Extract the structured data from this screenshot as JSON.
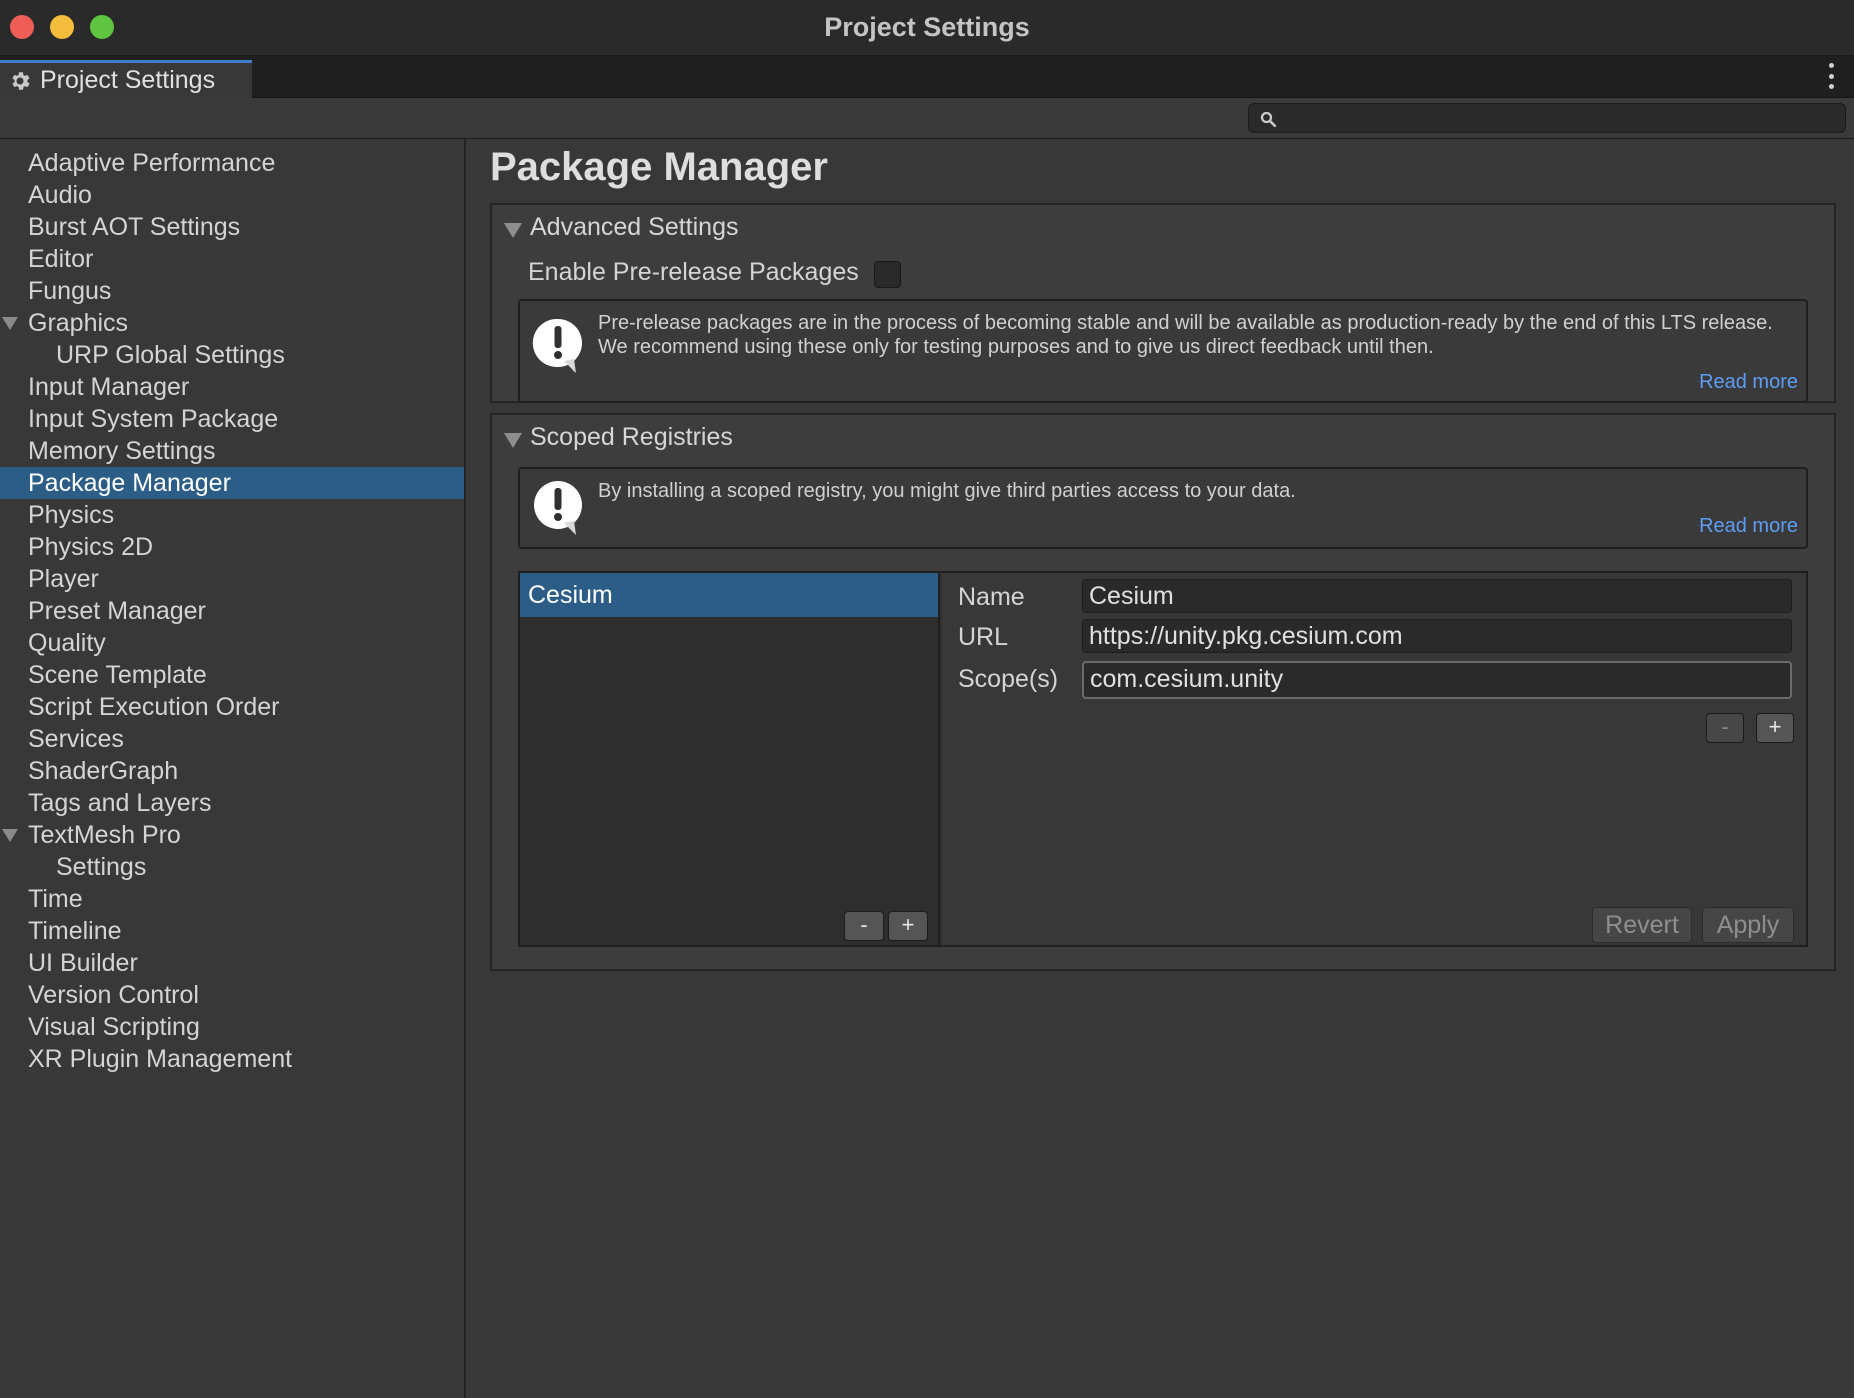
{
  "window": {
    "title": "Project Settings"
  },
  "tab": {
    "label": "Project Settings"
  },
  "search": {
    "placeholder": "",
    "value": ""
  },
  "sidebar": {
    "items": [
      {
        "label": "Adaptive Performance"
      },
      {
        "label": "Audio"
      },
      {
        "label": "Burst AOT Settings"
      },
      {
        "label": "Editor"
      },
      {
        "label": "Fungus"
      },
      {
        "label": "Graphics"
      },
      {
        "label": "URP Global Settings"
      },
      {
        "label": "Input Manager"
      },
      {
        "label": "Input System Package"
      },
      {
        "label": "Memory Settings"
      },
      {
        "label": "Package Manager"
      },
      {
        "label": "Physics"
      },
      {
        "label": "Physics 2D"
      },
      {
        "label": "Player"
      },
      {
        "label": "Preset Manager"
      },
      {
        "label": "Quality"
      },
      {
        "label": "Scene Template"
      },
      {
        "label": "Script Execution Order"
      },
      {
        "label": "Services"
      },
      {
        "label": "ShaderGraph"
      },
      {
        "label": "Tags and Layers"
      },
      {
        "label": "TextMesh Pro"
      },
      {
        "label": "Settings"
      },
      {
        "label": "Time"
      },
      {
        "label": "Timeline"
      },
      {
        "label": "UI Builder"
      },
      {
        "label": "Version Control"
      },
      {
        "label": "Visual Scripting"
      },
      {
        "label": "XR Plugin Management"
      }
    ],
    "selected": "Package Manager"
  },
  "main": {
    "title": "Package Manager",
    "advanced": {
      "header": "Advanced Settings",
      "prerelease_label": "Enable Pre-release Packages",
      "prerelease_checked": false,
      "help_text": "Pre-release packages are in the process of becoming stable and will be available as production-ready by the end of this LTS release. We recommend using these only for testing purposes and to give us direct feedback until then.",
      "read_more": "Read more"
    },
    "scoped": {
      "header": "Scoped Registries",
      "help_text": "By installing a scoped registry, you might give third parties access to your data.",
      "read_more": "Read more",
      "registries": [
        {
          "name": "Cesium"
        }
      ],
      "list_minus": "-",
      "list_plus": "+",
      "detail": {
        "name_label": "Name",
        "name_value": "Cesium",
        "url_label": "URL",
        "url_value": "https://unity.pkg.cesium.com",
        "scope_label": "Scope(s)",
        "scope_value": "com.cesium.unity",
        "scope_minus": "-",
        "scope_plus": "+",
        "revert": "Revert",
        "apply": "Apply"
      }
    }
  },
  "colors": {
    "accent_selection": "#2c5d87",
    "link": "#5d9cf5",
    "background": "#383838"
  }
}
